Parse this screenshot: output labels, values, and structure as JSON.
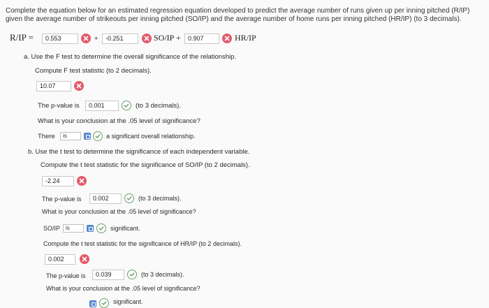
{
  "intro": {
    "line1": "Complete the equation below for an estimated regression equation developed to predict the average number of runs given up per inning pitched (R/IP)",
    "line2": "given the average number of strikeouts per inning pitched (SO/IP) and the average number of home runs per inning pitched (HR/IP) (to 3 decimals)."
  },
  "equation": {
    "lhs": "R/IP =",
    "b0": "0.553",
    "plus1": "+",
    "b1": "-0.251",
    "var1": "SO/IP +",
    "b2": "0.907",
    "var2": "HR/IP"
  },
  "part_a": {
    "label": "a.  Use the F test to determine the overall significance of the relationship.",
    "compute": "Compute F test statistic (to 2 decimals).",
    "f_value": "10.07",
    "pvalue_label": "The p-value is",
    "pvalue": "0.001",
    "pvalue_note": "(to 3 decimals).",
    "question": "What is your conclusion at the .05 level of significance?",
    "there": "There",
    "select": "is",
    "conclusion": "a significant overall relationship."
  },
  "part_b": {
    "label": "b.  Use the t test to determine the significance of each independent variable.",
    "compute_so": "Compute the t test statistic for the significance of SO/IP (to 2 decimals).",
    "t_so": "-2.24",
    "pvalue_label": "The p-value is",
    "pvalue_so": "0.002",
    "pvalue_note": "(to 3 decimals).",
    "question": "What is your conclusion at the .05 level of significance?",
    "so_var": "SO/IP",
    "select": "is",
    "significant": "significant.",
    "compute_hr": "Compute the t test statistic for the significance of HR/IP (to 2 decimals).",
    "t_hr": "0.002",
    "pvalue_hr": "0.039",
    "question2": "What is your conclusion at the .05 level of significance?",
    "significant2": "significant."
  },
  "colors": {
    "incorrect": "#e35b6b",
    "correct": "#6aa06a",
    "select_accent": "#5b8fd6"
  },
  "icons": {
    "incorrect": "x-circle-icon",
    "correct": "check-circle-icon"
  }
}
